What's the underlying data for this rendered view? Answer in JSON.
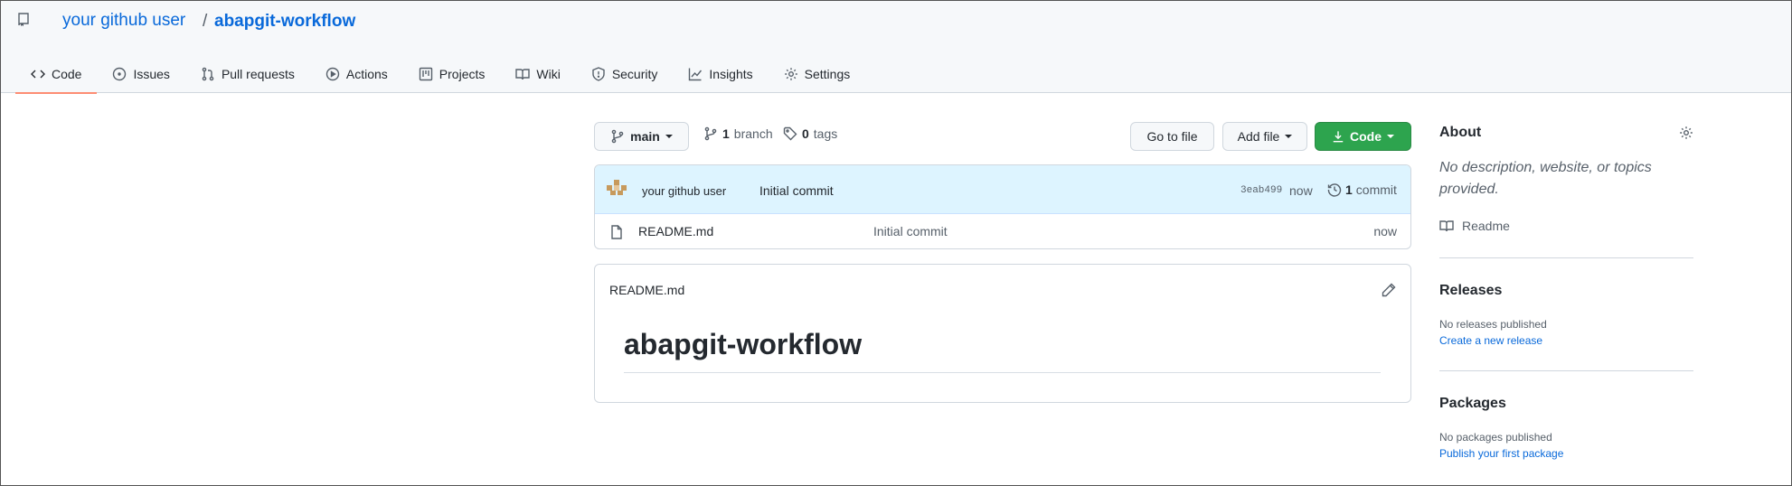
{
  "header": {
    "owner": "your github user",
    "separator": "/",
    "repo": "abapgit-workflow"
  },
  "tabs": [
    {
      "label": "Code",
      "icon": "code-icon",
      "active": true
    },
    {
      "label": "Issues",
      "icon": "issue-icon"
    },
    {
      "label": "Pull requests",
      "icon": "pull-request-icon"
    },
    {
      "label": "Actions",
      "icon": "play-icon"
    },
    {
      "label": "Projects",
      "icon": "project-icon"
    },
    {
      "label": "Wiki",
      "icon": "book-icon"
    },
    {
      "label": "Security",
      "icon": "shield-icon"
    },
    {
      "label": "Insights",
      "icon": "graph-icon"
    },
    {
      "label": "Settings",
      "icon": "gear-icon"
    }
  ],
  "toolbar": {
    "branch": "main",
    "branch_count": "1",
    "branch_label": "branch",
    "tag_count": "0",
    "tag_label": "tags",
    "go_to_file": "Go to file",
    "add_file": "Add file",
    "code": "Code"
  },
  "latest_commit": {
    "author": "your github user",
    "message": "Initial commit",
    "sha": "3eab499",
    "time": "now",
    "commit_count": "1",
    "commit_label": "commit"
  },
  "files": [
    {
      "name": "README.md",
      "message": "Initial commit",
      "time": "now"
    }
  ],
  "readme": {
    "filename": "README.md",
    "heading": "abapgit-workflow"
  },
  "sidebar": {
    "about_title": "About",
    "about_desc_line1": "No description, website, or topics",
    "about_desc_line2": "provided.",
    "readme_link": "Readme",
    "releases_title": "Releases",
    "releases_none": "No releases published",
    "releases_link": "Create a new release",
    "packages_title": "Packages",
    "packages_none": "No packages published",
    "packages_link": "Publish your first package"
  },
  "colors": {
    "accent": "#0969da",
    "green": "#2da44e",
    "tab_underline": "#fd8c73",
    "commit_bar": "#ddf4ff"
  }
}
